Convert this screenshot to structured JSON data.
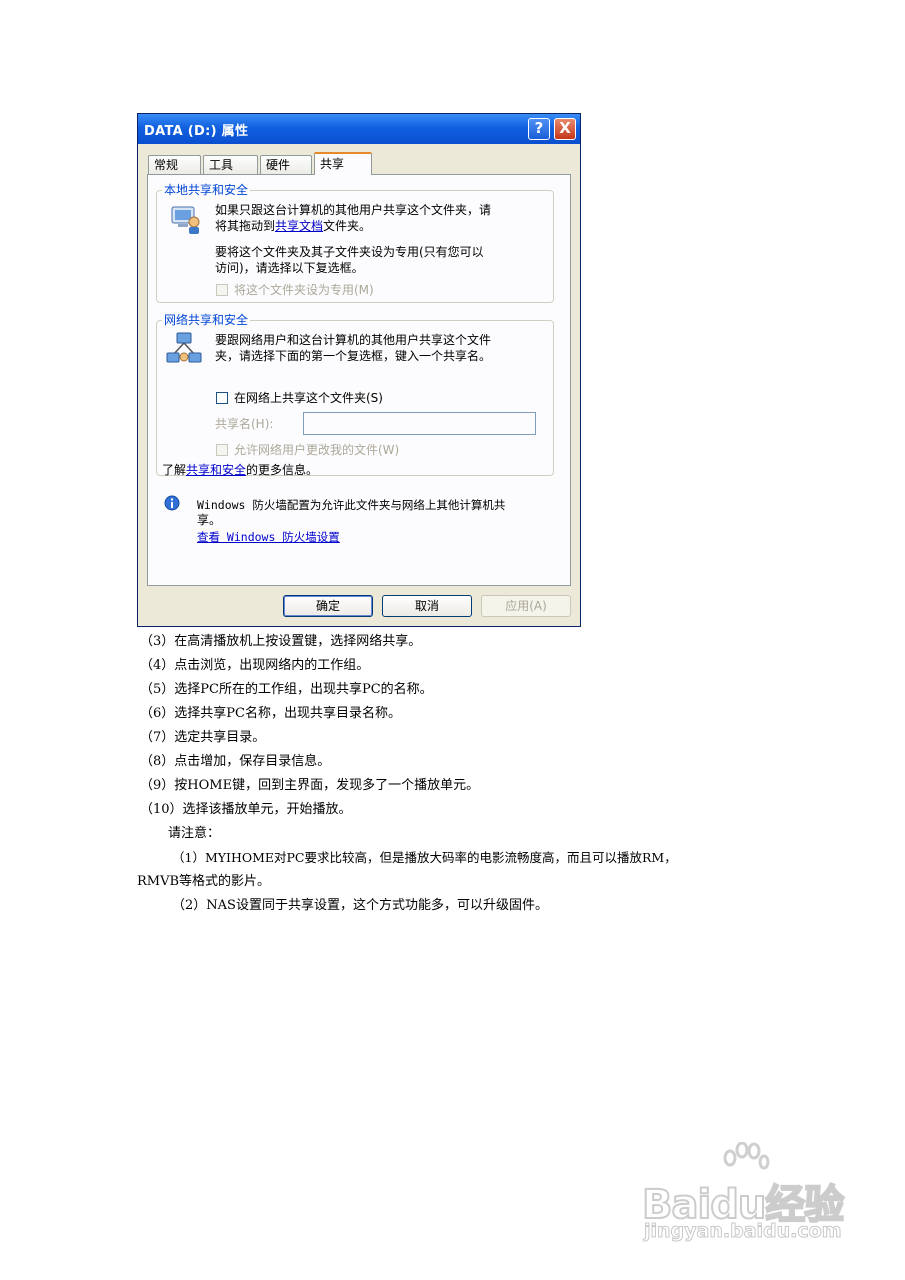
{
  "dialog": {
    "title": "DATA (D:) 属性",
    "help_label": "?",
    "close_label": "X",
    "tabs": [
      {
        "label": "常规",
        "active": false
      },
      {
        "label": "工具",
        "active": false
      },
      {
        "label": "硬件",
        "active": false
      },
      {
        "label": "共享",
        "active": true
      }
    ],
    "local_group": {
      "title": "本地共享和安全",
      "line1": "如果只跟这台计算机的其他用户共享这个文件夹，请",
      "line2_pre": "将其拖动到",
      "line2_link": "共享文档",
      "line2_post": "文件夹。",
      "line3": "要将这个文件夹及其子文件夹设为专用(只有您可以",
      "line4": "访问)，请选择以下复选框。",
      "private_checkbox": "将这个文件夹设为专用(M)"
    },
    "network_group": {
      "title": "网络共享和安全",
      "line1": "要跟网络用户和这台计算机的其他用户共享这个文件",
      "line2": "夹，请选择下面的第一个复选框，键入一个共享名。",
      "share_checkbox": "在网络上共享这个文件夹(S)",
      "share_name_label": "共享名(H):",
      "share_name_value": "",
      "allow_change_checkbox": "允许网络用户更改我的文件(W)",
      "learn_pre": "了解",
      "learn_link": "共享和安全",
      "learn_post": "的更多信息。"
    },
    "firewall": {
      "line1": "Windows 防火墙配置为允许此文件夹与网络上其他计算机共",
      "line2": "享。",
      "link": "查看 Windows 防火墙设置"
    },
    "buttons": {
      "ok": "确定",
      "cancel": "取消",
      "apply": "应用(A)"
    }
  },
  "document": {
    "steps": [
      "（3）在高清播放机上按设置键，选择网络共享。",
      "（4）点击浏览，出现网络内的工作组。",
      "（5）选择PC所在的工作组，出现共享PC的名称。",
      "（6）选择共享PC名称，出现共享目录名称。",
      "（7）选定共享目录。",
      "（8）点击增加，保存目录信息。",
      "（9）按HOME键，回到主界面，发现多了一个播放单元。",
      "（10）选择该播放单元，开始播放。"
    ],
    "note_heading": "请注意：",
    "note1_line1": "（1）MYIHOME对PC要求比较高，但是播放大码率的电影流畅度高，而且可以播放RM，",
    "note1_line2": "RMVB等格式的影片。",
    "note2": "（2）NAS设置同于共享设置，这个方式功能多，可以升级固件。"
  },
  "watermark": {
    "logo": "Baidu经验",
    "url": "jingyan.baidu.com"
  }
}
